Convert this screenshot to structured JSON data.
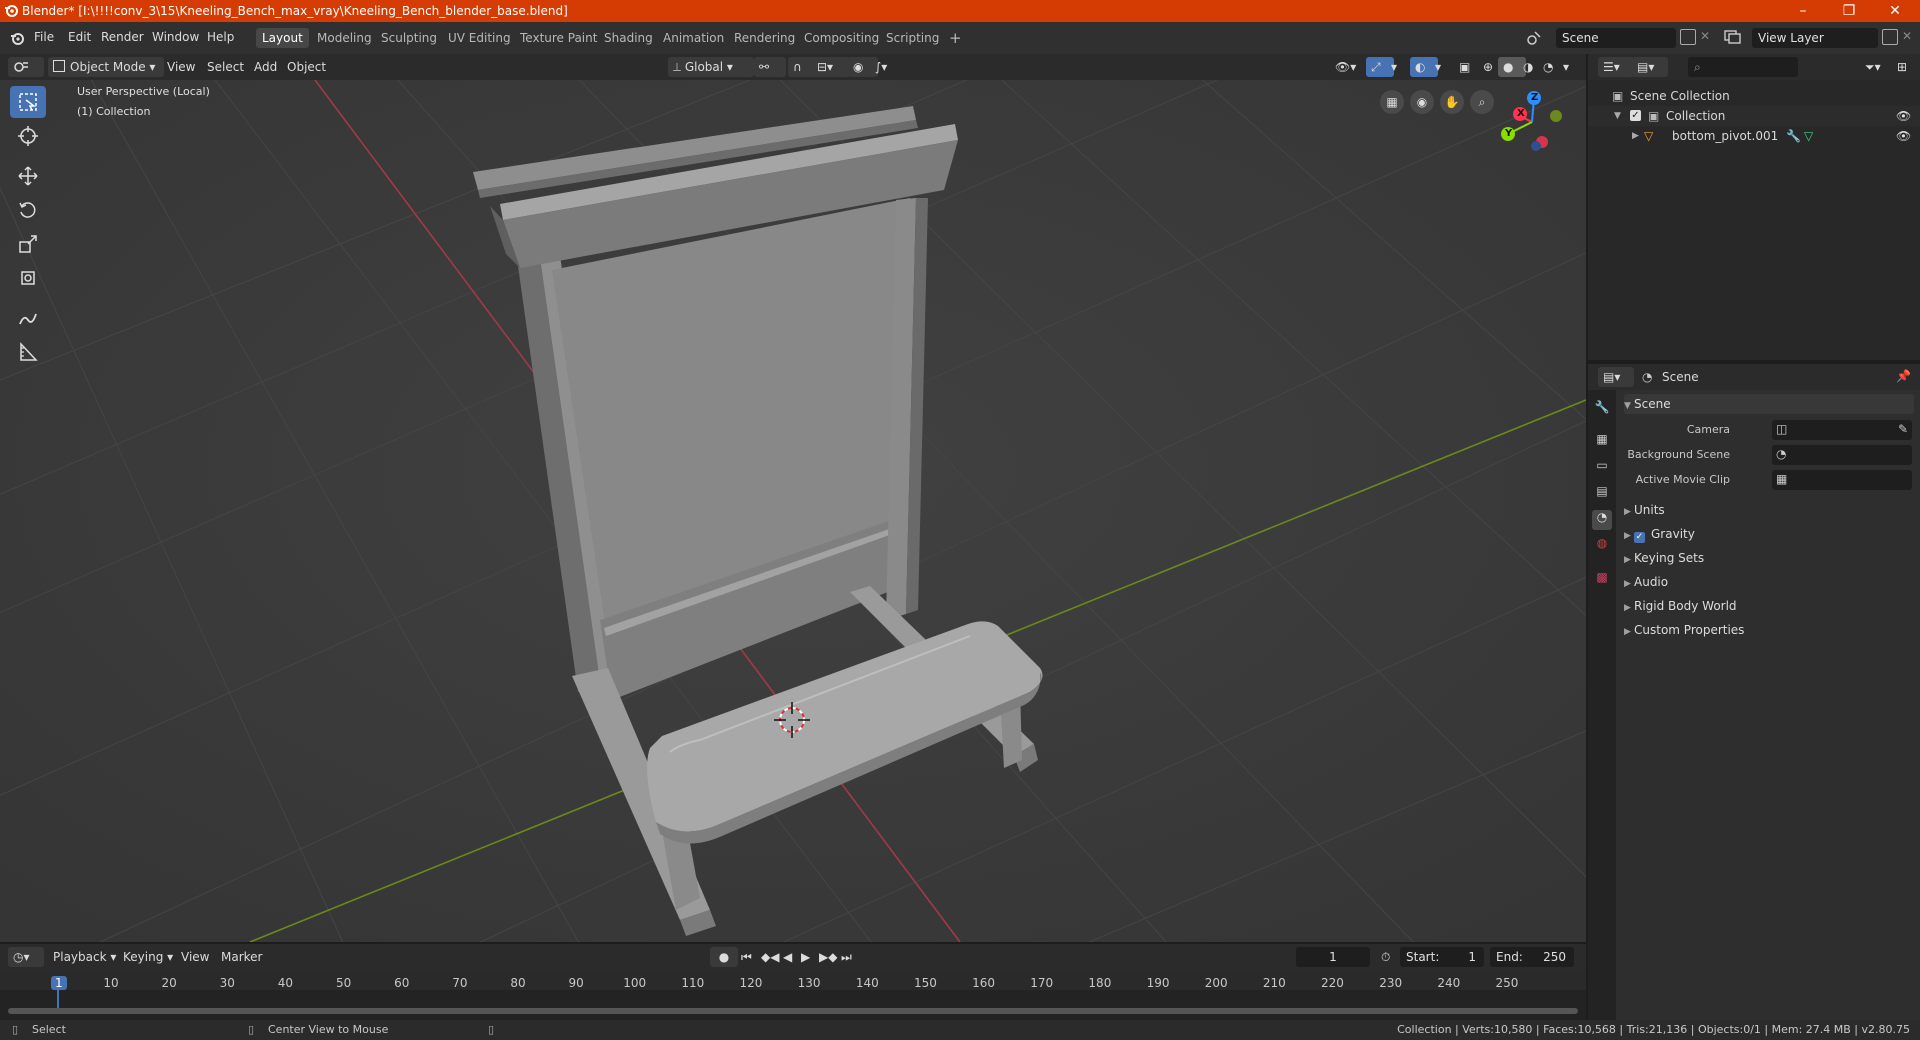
{
  "window": {
    "title": "Blender* [I:\\!!!!conv_3\\15\\Kneeling_Bench_max_vray\\Kneeling_Bench_blender_base.blend]",
    "minimize": "–",
    "maximize": "❐",
    "close": "✕"
  },
  "menu": {
    "items": [
      "File",
      "Edit",
      "Render",
      "Window",
      "Help"
    ]
  },
  "workspaces": {
    "tabs": [
      "Layout",
      "Modeling",
      "Sculpting",
      "UV Editing",
      "Texture Paint",
      "Shading",
      "Animation",
      "Rendering",
      "Compositing",
      "Scripting"
    ],
    "add": "+"
  },
  "topbar": {
    "scene": "Scene",
    "view_layer": "View Layer"
  },
  "viewport_header": {
    "mode": "Object Mode",
    "menus": [
      "View",
      "Select",
      "Add",
      "Object"
    ],
    "transform_orientation": "Global"
  },
  "viewport": {
    "perspective": "User Perspective (Local)",
    "collection": "(1) Collection",
    "gizmo": {
      "x": "X",
      "y": "Y",
      "z": "Z"
    }
  },
  "outliner": {
    "root": "Scene Collection",
    "collection": "Collection",
    "object": "bottom_pivot.001"
  },
  "properties": {
    "header": "Scene",
    "section": "Scene",
    "fields": [
      {
        "label": "Camera"
      },
      {
        "label": "Background Scene"
      },
      {
        "label": "Active Movie Clip"
      }
    ],
    "panels": [
      "Units",
      "Gravity",
      "Keying Sets",
      "Audio",
      "Rigid Body World",
      "Custom Properties"
    ]
  },
  "timeline": {
    "menus": [
      "Playback",
      "Keying",
      "View",
      "Marker"
    ],
    "current_frame": "1",
    "start_label": "Start:",
    "start": "1",
    "end_label": "End:",
    "end": "250",
    "ticks": [
      "1",
      "10",
      "20",
      "30",
      "40",
      "50",
      "60",
      "70",
      "80",
      "90",
      "100",
      "110",
      "120",
      "130",
      "140",
      "150",
      "160",
      "170",
      "180",
      "190",
      "200",
      "210",
      "220",
      "230",
      "240",
      "250"
    ]
  },
  "statusbar": {
    "left": "Select",
    "middle": "Center View to Mouse",
    "right": "Collection | Verts:10,580 | Faces:10,568 | Tris:21,136 | Objects:0/1 | Mem: 27.4 MB | v2.80.75"
  },
  "colors": {
    "accent": "#4772b3",
    "titlebar": "#d53c03",
    "x_axis": "#ff3352",
    "y_axis": "#8bdc00",
    "z_axis": "#2890ff"
  }
}
